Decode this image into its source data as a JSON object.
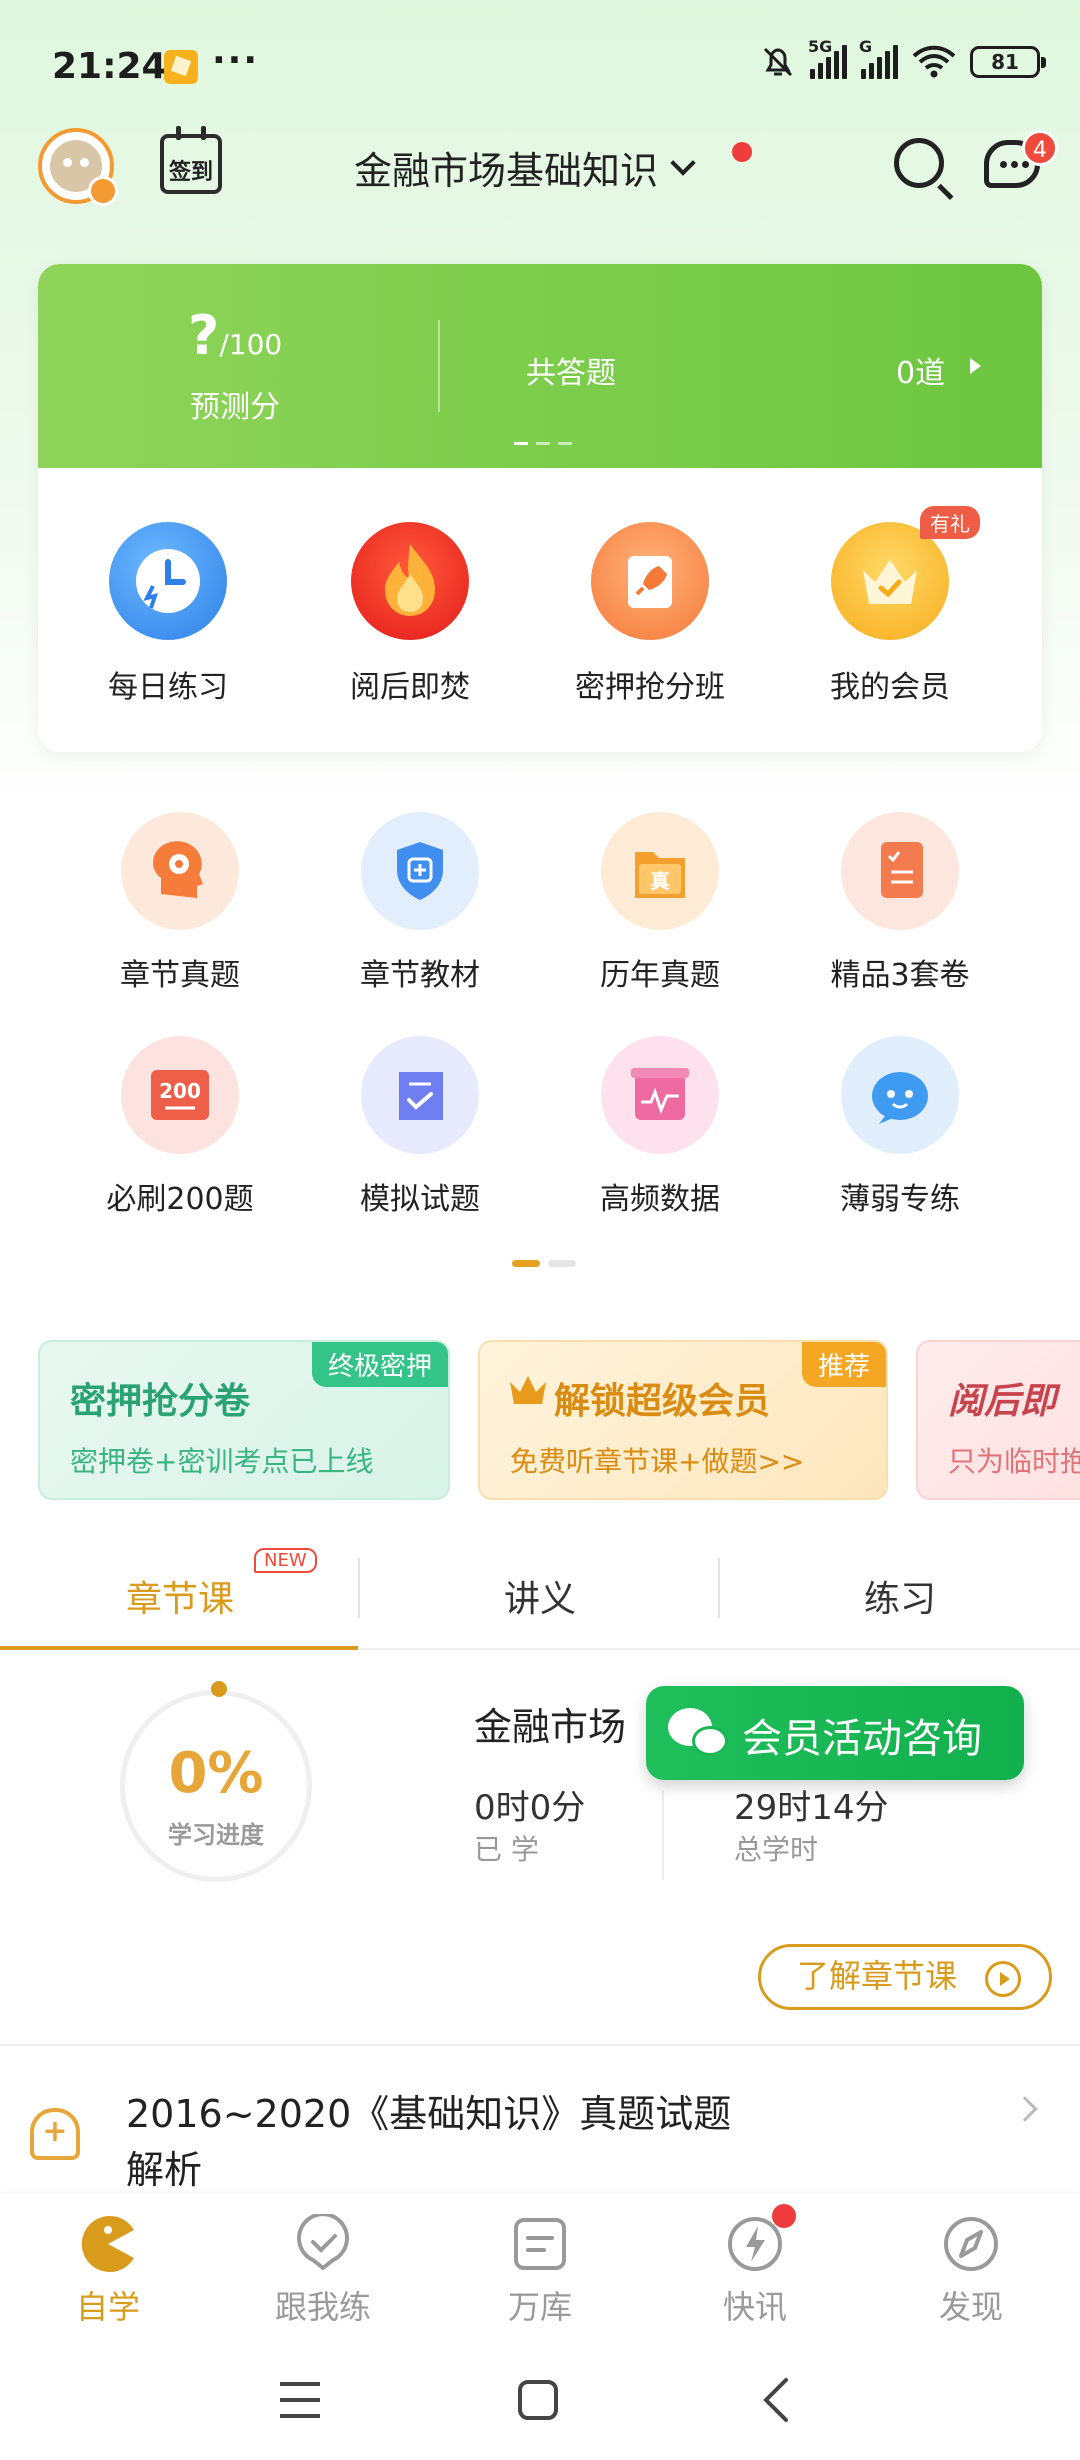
{
  "status_bar": {
    "time": "21:24",
    "more": "···",
    "battery": "81",
    "net1": "5G",
    "net2": "G"
  },
  "header": {
    "signin_label": "签到",
    "subject_title": "金融市场基础知识",
    "message_badge": "4"
  },
  "score_card": {
    "score": "?",
    "score_total": "/100",
    "score_label": "预测分",
    "answered_label": "共答题",
    "answered_count": "0道",
    "quick_actions": [
      {
        "label": "每日练习",
        "icon": "clock-lightning-icon"
      },
      {
        "label": "阅后即焚",
        "icon": "fire-icon"
      },
      {
        "label": "密押抢分班",
        "icon": "rocket-icon"
      },
      {
        "label": "我的会员",
        "icon": "crown-icon",
        "badge": "有礼"
      }
    ]
  },
  "grid": [
    {
      "label": "章节真题",
      "icon": "head-gear-icon",
      "color": "#f57c3a",
      "bg": "#fde9dc"
    },
    {
      "label": "章节教材",
      "icon": "shield-plus-icon",
      "color": "#3f8ef0",
      "bg": "#e3eefc"
    },
    {
      "label": "历年真题",
      "icon": "folder-zhen-icon",
      "color": "#f3a02e",
      "bg": "#fdebd6"
    },
    {
      "label": "精品3套卷",
      "icon": "checklist-icon",
      "color": "#f47b4f",
      "bg": "#fde6de"
    },
    {
      "label": "必刷200题",
      "icon": "board-200-icon",
      "color": "#ee5f4a",
      "bg": "#fde3df"
    },
    {
      "label": "模拟试题",
      "icon": "scroll-check-icon",
      "color": "#6f7ef0",
      "bg": "#e7e9fc"
    },
    {
      "label": "高频数据",
      "icon": "chart-box-icon",
      "color": "#ee6aa0",
      "bg": "#fde2ee"
    },
    {
      "label": "薄弱专练",
      "icon": "robot-icon",
      "color": "#3f9bf2",
      "bg": "#e0eefc"
    }
  ],
  "grid_num_label": "200",
  "grid_zhen_label": "真",
  "promos": [
    {
      "title": "密押抢分卷",
      "subtitle": "密押卷+密训考点已上线",
      "tag": "终极密押"
    },
    {
      "title": "解锁超级会员",
      "subtitle": "免费听章节课+做题>>",
      "tag": "推荐"
    },
    {
      "title": "阅后即",
      "subtitle": "只为临时抱"
    }
  ],
  "tabs": [
    {
      "label": "章节课",
      "badge": "NEW"
    },
    {
      "label": "讲义"
    },
    {
      "label": "练习"
    }
  ],
  "course": {
    "progress_percent": "0%",
    "progress_label": "学习进度",
    "title": "金融市场",
    "learned_value": "0时0分",
    "learned_label": "已 学",
    "total_value": "29时14分",
    "total_label": "总学时",
    "learn_button": "了解章节课"
  },
  "floating_button": "会员活动咨询",
  "exam": {
    "title": "2016~2020《基础知识》真题试题解析"
  },
  "bottom_nav": [
    {
      "label": "自学",
      "icon": "pacman-icon"
    },
    {
      "label": "跟我练",
      "icon": "check-circle-icon"
    },
    {
      "label": "万库",
      "icon": "document-icon"
    },
    {
      "label": "快讯",
      "icon": "lightning-icon"
    },
    {
      "label": "发现",
      "icon": "compass-icon"
    }
  ],
  "colors": {
    "accent": "#d99b1c",
    "green": "#6cc63f",
    "wechat": "#1ab654",
    "badge_red": "#ef3b3b"
  }
}
